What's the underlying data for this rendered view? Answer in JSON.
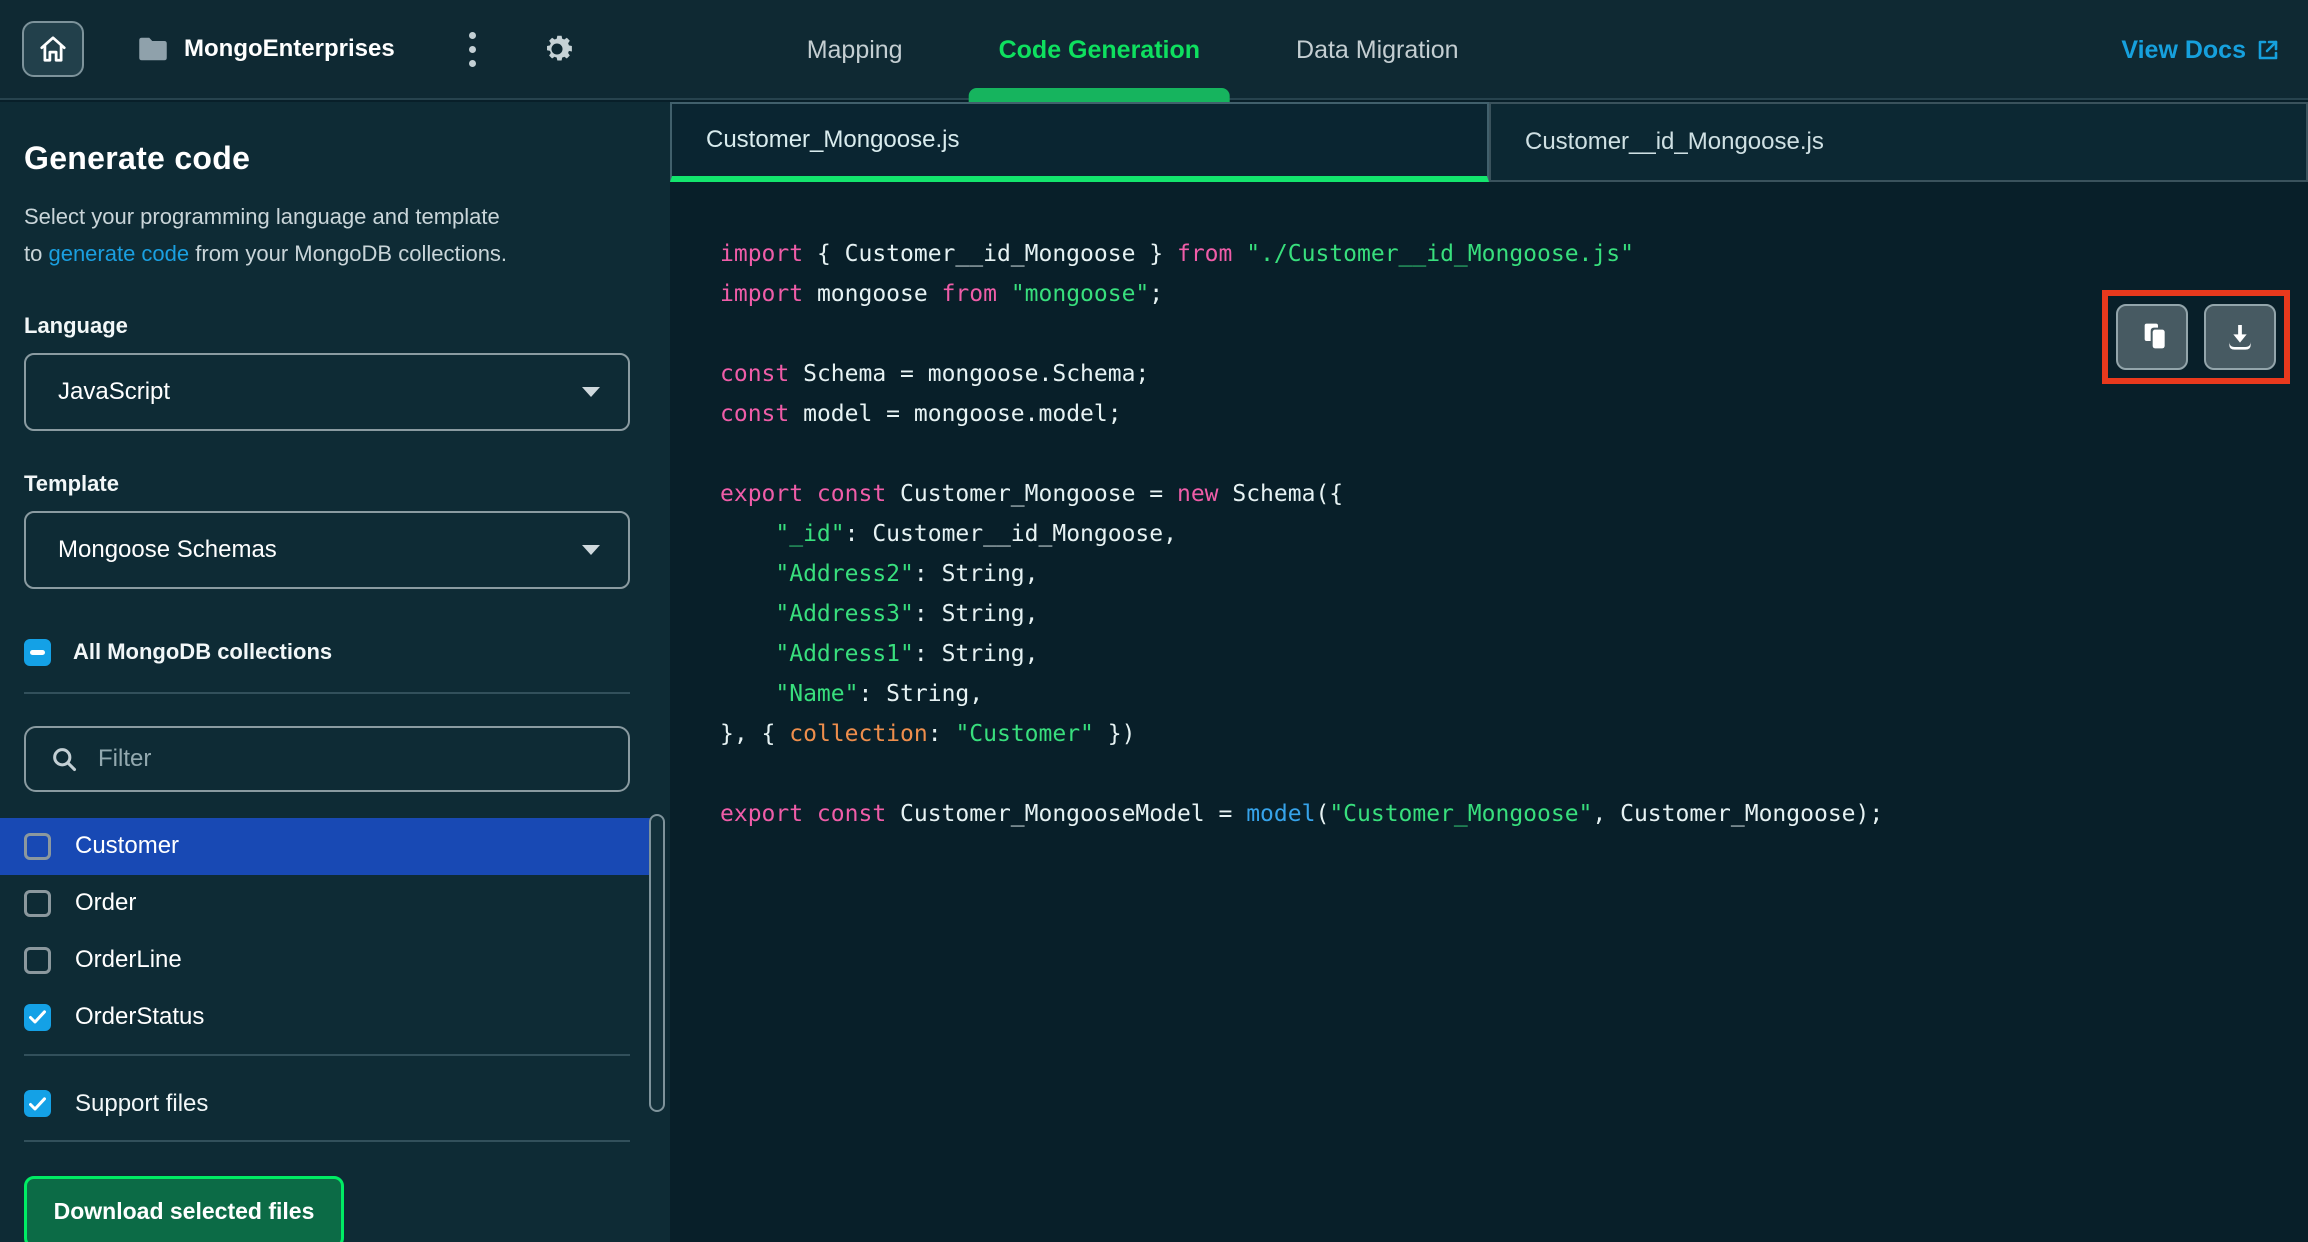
{
  "topbar": {
    "project_name": "MongoEnterprises",
    "tabs": [
      {
        "label": "Mapping",
        "active": false
      },
      {
        "label": "Code Generation",
        "active": true
      },
      {
        "label": "Data Migration",
        "active": false
      }
    ],
    "view_docs_label": "View Docs"
  },
  "sidebar": {
    "title": "Generate code",
    "description_line1": "Select your programming language and template",
    "description_line2_prefix": "to ",
    "description_link_text": "generate code",
    "description_line2_suffix": " from your MongoDB collections.",
    "language_label": "Language",
    "language_value": "JavaScript",
    "template_label": "Template",
    "template_value": "Mongoose Schemas",
    "all_collections_label": "All MongoDB collections",
    "all_collections_state": "indeterminate",
    "filter_placeholder": "Filter",
    "collections": [
      {
        "name": "Customer",
        "checked": false,
        "selected": true
      },
      {
        "name": "Order",
        "checked": false,
        "selected": false
      },
      {
        "name": "OrderLine",
        "checked": false,
        "selected": false
      },
      {
        "name": "OrderStatus",
        "checked": true,
        "selected": false
      }
    ],
    "support_files_label": "Support files",
    "support_files_checked": true,
    "download_button_label": "Download selected files"
  },
  "editor": {
    "file_tabs": [
      {
        "label": "Customer_Mongoose.js",
        "active": true
      },
      {
        "label": "Customer__id_Mongoose.js",
        "active": false
      }
    ],
    "actions": [
      "copy",
      "download"
    ],
    "code_lines": [
      [
        [
          "k",
          "import "
        ],
        [
          "p",
          "{ Customer__id_Mongoose } "
        ],
        [
          "k",
          "from "
        ],
        [
          "s",
          "\"./Customer__id_Mongoose.js\""
        ]
      ],
      [
        [
          "k",
          "import "
        ],
        [
          "p",
          "mongoose "
        ],
        [
          "k",
          "from "
        ],
        [
          "s",
          "\"mongoose\""
        ],
        [
          "p",
          ";"
        ]
      ],
      [],
      [
        [
          "k",
          "const "
        ],
        [
          "p",
          "Schema = mongoose.Schema;"
        ]
      ],
      [
        [
          "k",
          "const "
        ],
        [
          "p",
          "model = mongoose.model;"
        ]
      ],
      [],
      [
        [
          "k",
          "export const "
        ],
        [
          "p",
          "Customer_Mongoose = "
        ],
        [
          "k",
          "new "
        ],
        [
          "p",
          "Schema({"
        ]
      ],
      [
        [
          "p",
          "    "
        ],
        [
          "s",
          "\"_id\""
        ],
        [
          "p",
          ": Customer__id_Mongoose,"
        ]
      ],
      [
        [
          "p",
          "    "
        ],
        [
          "s",
          "\"Address2\""
        ],
        [
          "p",
          ": String,"
        ]
      ],
      [
        [
          "p",
          "    "
        ],
        [
          "s",
          "\"Address3\""
        ],
        [
          "p",
          ": String,"
        ]
      ],
      [
        [
          "p",
          "    "
        ],
        [
          "s",
          "\"Address1\""
        ],
        [
          "p",
          ": String,"
        ]
      ],
      [
        [
          "p",
          "    "
        ],
        [
          "s",
          "\"Name\""
        ],
        [
          "p",
          ": String,"
        ]
      ],
      [
        [
          "p",
          "}, { "
        ],
        [
          "o",
          "collection"
        ],
        [
          "p",
          ": "
        ],
        [
          "s",
          "\"Customer\""
        ],
        [
          "p",
          " })"
        ]
      ],
      [],
      [
        [
          "k",
          "export const "
        ],
        [
          "p",
          "Customer_MongooseModel = "
        ],
        [
          "f",
          "model"
        ],
        [
          "p",
          "("
        ],
        [
          "s",
          "\"Customer_Mongoose\""
        ],
        [
          "p",
          ", Customer_Mongoose);"
        ]
      ]
    ]
  },
  "colors": {
    "accent_green": "#00ed64",
    "tab_green": "#0ee05f",
    "link_blue": "#1a9fe0",
    "docs_blue": "#16a0dd",
    "checkbox_blue": "#14a1e6",
    "selected_row_blue": "#1849b4",
    "highlight_red": "#e8391d",
    "keyword_pink": "#ef5da8",
    "string_green": "#38df7d",
    "orange": "#ee8e4c",
    "function_blue": "#36a3ea"
  }
}
